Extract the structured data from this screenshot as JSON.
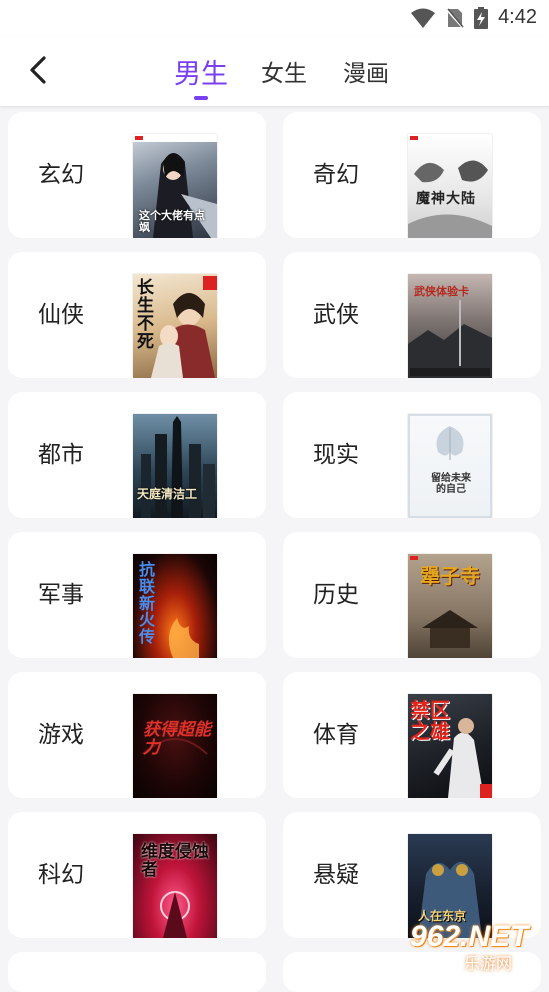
{
  "status": {
    "time": "4:42"
  },
  "header": {
    "tabs": [
      {
        "label": "男生",
        "active": true
      },
      {
        "label": "女生",
        "active": false
      },
      {
        "label": "漫画",
        "active": false
      }
    ]
  },
  "accent_color": "#7b3ff2",
  "categories": [
    {
      "label": "玄幻",
      "cover_text": "这个大佬有点飒"
    },
    {
      "label": "奇幻",
      "cover_text": "魔神大陆"
    },
    {
      "label": "仙侠",
      "cover_text": "长生不死"
    },
    {
      "label": "武侠",
      "cover_text": "武侠体验卡"
    },
    {
      "label": "都市",
      "cover_text": "天庭清洁工"
    },
    {
      "label": "现实",
      "cover_text": "留给未来的自己"
    },
    {
      "label": "军事",
      "cover_text": "抗联新火传"
    },
    {
      "label": "历史",
      "cover_text": "犟子寺"
    },
    {
      "label": "游戏",
      "cover_text": "获得超能力"
    },
    {
      "label": "体育",
      "cover_text": "禁区之雄"
    },
    {
      "label": "科幻",
      "cover_text": "维度侵蚀者"
    },
    {
      "label": "悬疑",
      "cover_text": "人在东京"
    }
  ],
  "watermark": {
    "main": "962.NET",
    "sub": "乐游网"
  }
}
